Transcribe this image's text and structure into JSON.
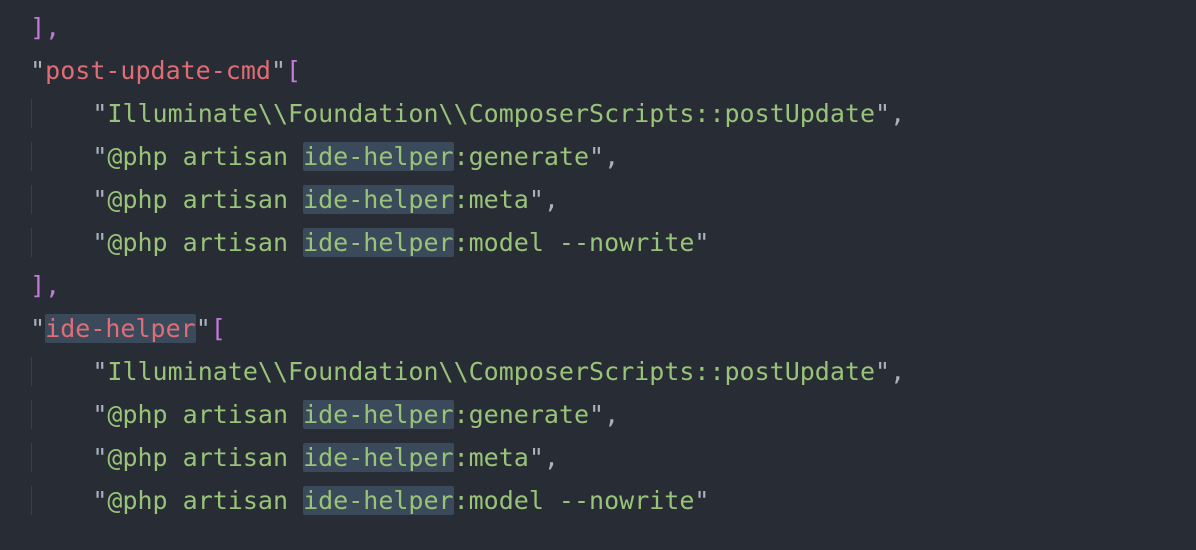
{
  "colors": {
    "background": "#282c34",
    "key": "#e06c75",
    "string": "#98c379",
    "punct": "#abb2bf",
    "bracket": "#c678dd",
    "highlight": "#3b4a5a"
  },
  "highlight_term": "ide-helper",
  "code": {
    "line0_trail": "],",
    "key1": "post-update-cmd",
    "key2": "ide-helper",
    "arr_open": "[",
    "arr_close": "],",
    "block1": [
      "Illuminate\\\\Foundation\\\\ComposerScripts::postUpdate",
      "@php artisan ide-helper:generate",
      "@php artisan ide-helper:meta",
      "@php artisan ide-helper:model --nowrite"
    ],
    "block2": [
      "Illuminate\\\\Foundation\\\\ComposerScripts::postUpdate",
      "@php artisan ide-helper:generate",
      "@php artisan ide-helper:meta",
      "@php artisan ide-helper:model --nowrite"
    ]
  },
  "q": "\"",
  "colon_open": ": ",
  "comma": ","
}
